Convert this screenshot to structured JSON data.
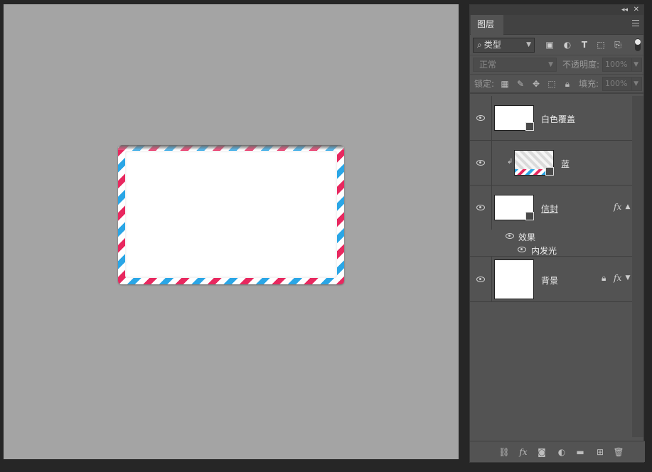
{
  "panel": {
    "tab_label": "图层",
    "filter": {
      "label": "类型"
    },
    "blend_mode": "正常",
    "opacity_label": "不透明度:",
    "opacity_value": "100%",
    "lock_label": "锁定:",
    "fill_label": "填充:",
    "fill_value": "100%"
  },
  "layers": [
    {
      "name": "白色覆盖"
    },
    {
      "name": "蓝"
    },
    {
      "name": "信封",
      "fx": "fx",
      "effects_label": "效果",
      "effect_name": "内发光"
    },
    {
      "name": "背景",
      "fx": "fx"
    }
  ],
  "colors": {
    "stripe_red": "#e8285f",
    "stripe_blue": "#2aa6e6",
    "canvas_bg": "#a4a4a4",
    "panel_bg": "#535353"
  },
  "icons": [
    "collapse-icon",
    "close-panel-icon",
    "panel-menu-icon",
    "search-icon",
    "image-filter-icon",
    "adjustment-filter-icon",
    "type-filter-icon",
    "shape-filter-icon",
    "smart-object-filter-icon",
    "lock-transparent-icon",
    "lock-brush-icon",
    "lock-move-icon",
    "lock-artboard-icon",
    "lock-all-icon",
    "eye-icon",
    "lock-icon",
    "link-icon",
    "fx-icon",
    "mask-icon",
    "adjustment-icon",
    "folder-icon",
    "new-layer-icon",
    "trash-icon"
  ]
}
